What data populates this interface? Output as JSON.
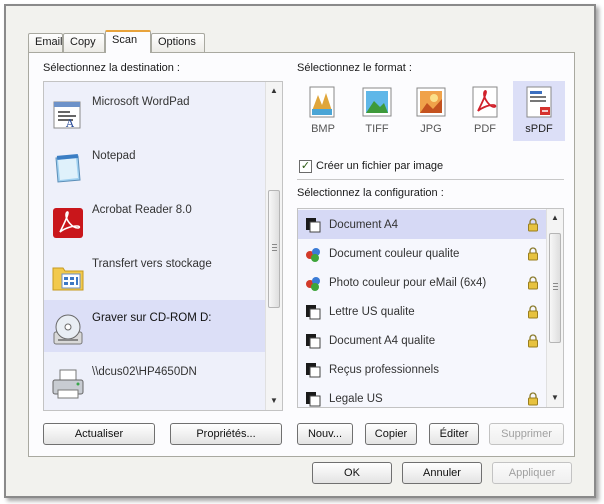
{
  "tabs": [
    "Email",
    "Copy",
    "Scan",
    "Options"
  ],
  "active_tab": "Scan",
  "destination": {
    "label": "Sélectionnez la destination :",
    "items": [
      {
        "name": "Microsoft WordPad",
        "icon": "wordpad-icon"
      },
      {
        "name": "Notepad",
        "icon": "notepad-icon"
      },
      {
        "name": "Acrobat Reader 8.0",
        "icon": "acrobat-icon"
      },
      {
        "name": "Transfert vers stockage",
        "icon": "storage-folder-icon"
      },
      {
        "name": "Graver sur CD-ROM  D:",
        "icon": "cd-burn-icon"
      },
      {
        "name": "\\\\dcus02\\HP4650DN",
        "icon": "printer-icon"
      }
    ],
    "selected": "Graver sur CD-ROM  D:"
  },
  "format": {
    "label": "Sélectionnez le format :",
    "items": [
      "BMP",
      "TIFF",
      "JPG",
      "PDF",
      "sPDF"
    ],
    "selected": "sPDF",
    "checkbox_label": "Créer un fichier par image",
    "checkbox_checked": true
  },
  "configuration": {
    "label": "Sélectionnez la configuration :",
    "items": [
      {
        "name": "Document A4",
        "icon": "bw-doc-icon",
        "locked": true
      },
      {
        "name": "Document couleur qualite",
        "icon": "color-doc-icon",
        "locked": true
      },
      {
        "name": "Photo couleur pour eMail (6x4)",
        "icon": "color-doc-icon",
        "locked": true
      },
      {
        "name": "Lettre US qualite",
        "icon": "bw-doc-icon",
        "locked": true
      },
      {
        "name": "Document A4 qualite",
        "icon": "bw-doc-icon",
        "locked": true
      },
      {
        "name": "Reçus professionnels",
        "icon": "bw-doc-icon",
        "locked": false
      },
      {
        "name": "Legale US",
        "icon": "bw-doc-icon",
        "locked": true
      }
    ],
    "selected": "Document A4"
  },
  "buttons": {
    "refresh": "Actualiser",
    "properties": "Propriétés...",
    "new": "Nouv...",
    "copy": "Copier",
    "edit": "Éditer",
    "delete": "Supprimer",
    "ok": "OK",
    "cancel": "Annuler",
    "apply": "Appliquer"
  },
  "colors": {
    "selection": "#dcdff7",
    "active_tab_accent": "#e8a33c",
    "lock": "#e7c23f"
  }
}
